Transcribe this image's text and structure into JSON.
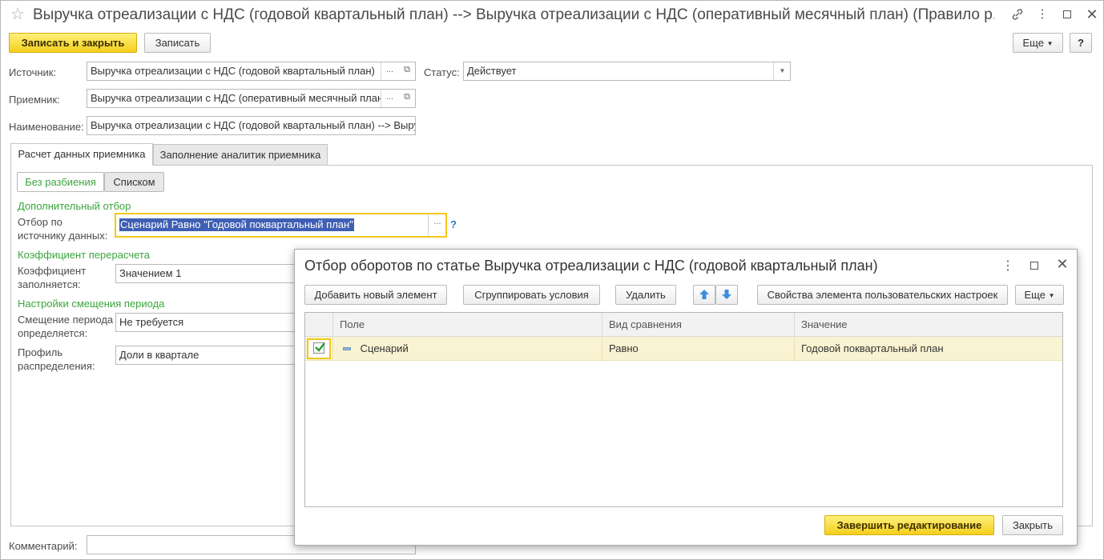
{
  "window": {
    "title": "Выручка отреализации с НДС (годовой квартальный план) --> Выручка отреализации с НДС (оперативный месячный план) (Правило р...",
    "icons": [
      "star-icon",
      "link-icon",
      "more-icon",
      "maximize-icon",
      "close-icon"
    ]
  },
  "toolbar": {
    "save_close": "Записать и закрыть",
    "save": "Записать",
    "more": "Еще",
    "help": "?"
  },
  "form": {
    "source_label": "Источник:",
    "source_value": "Выручка отреализации с НДС (годовой квартальный план)",
    "receiver_label": "Приемник:",
    "receiver_value": "Выручка отреализации с НДС (оперативный месячный план",
    "name_label": "Наименование:",
    "name_value": "Выручка отреализации с НДС (годовой квартальный план) --> Выру",
    "status_label": "Статус:",
    "status_value": "Действует",
    "comment_label": "Комментарий:",
    "comment_value": ""
  },
  "tabs": [
    {
      "label": "Расчет данных приемника",
      "active": true
    },
    {
      "label": "Заполнение аналитик приемника",
      "active": false
    }
  ],
  "subtabs": [
    {
      "label": "Без разбиения",
      "active": true
    },
    {
      "label": "Списком",
      "active": false
    }
  ],
  "sections": {
    "extra_filter": "Дополнительный отбор",
    "filter_label_1": "Отбор по",
    "filter_label_2": "источнику данных:",
    "filter_value": "Сценарий Равно \"Годовой поквартальный план\"",
    "filter_help": "?",
    "coef_title": "Коэффициент перерасчета",
    "coef_label_1": "Коэффициент",
    "coef_label_2": "заполняется:",
    "coef_value": "Значением 1",
    "shift_title": "Настройки смещения периода",
    "shift_label_1": "Смещение периода",
    "shift_label_2": "определяется:",
    "shift_value": "Не требуется",
    "profile_label_1": "Профиль",
    "profile_label_2": "распределения:",
    "profile_value": "Доли в квартале"
  },
  "dialog": {
    "title": "Отбор оборотов по статье Выручка отреализации с НДС (годовой квартальный план)",
    "buttons": {
      "add": "Добавить новый элемент",
      "group": "Сгруппировать условия",
      "delete": "Удалить",
      "props": "Свойства элемента пользовательских настроек",
      "more": "Еще",
      "finish": "Завершить редактирование",
      "close": "Закрыть"
    },
    "columns": [
      "Поле",
      "Вид сравнения",
      "Значение"
    ],
    "rows": [
      {
        "checked": true,
        "field": "Сценарий",
        "comparison": "Равно",
        "value": "Годовой поквартальный план"
      }
    ]
  },
  "colors": {
    "accent_yellow": "#f4cf1d",
    "section_green": "#3aa63c",
    "selection_blue": "#3f5fb4",
    "row_highlight": "#faf3d1",
    "arrow_blue": "#3b8ee0"
  }
}
